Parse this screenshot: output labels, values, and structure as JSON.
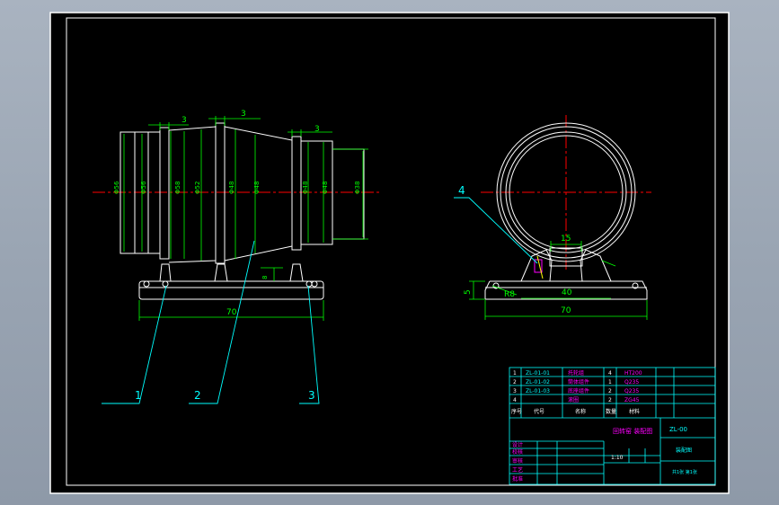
{
  "colors": {
    "background": "#000000",
    "frame": "#ffffff",
    "geometry": "#ffffff",
    "dimension": "#00ff00",
    "centerline": "#ff0000",
    "leader": "#00ffff",
    "table_line": "#00ffff",
    "table_text": "#ff00ff"
  },
  "front_view": {
    "top_dims": [
      "3",
      "3",
      "3"
    ],
    "bottom_dim": "70",
    "right_dim": "8",
    "diameter_labels": [
      "Φ56",
      "Φ56",
      "Φ58",
      "Φ52",
      "Φ48",
      "Φ48",
      "Φ48",
      "Φ48",
      "Φ44",
      "Φ44",
      "Φ38"
    ]
  },
  "side_view": {
    "ring_top_dim": "15",
    "foot_height_dim": "5",
    "radius_dim": "R8",
    "span_dim": "40",
    "base_dim": "70"
  },
  "callouts": [
    "1",
    "2",
    "3",
    "4"
  ],
  "title_block": {
    "rows": [
      {
        "no": "1",
        "code": "ZL-01-01",
        "name": "托轮组",
        "qty": "4",
        "mat": "HT200"
      },
      {
        "no": "2",
        "code": "ZL-01-02",
        "name": "筒体组件",
        "qty": "1",
        "mat": "Q235"
      },
      {
        "no": "3",
        "code": "ZL-01-03",
        "name": "底座组件",
        "qty": "2",
        "mat": "Q235"
      },
      {
        "no": "4",
        "code": "",
        "name": "滚圈",
        "qty": "2",
        "mat": "ZG45"
      }
    ],
    "header": [
      "序号",
      "代号",
      "名称",
      "数量",
      "材料"
    ],
    "design_title": "回转窑 装配图",
    "drawing_no": "ZL-00",
    "assembly_label": "装配图",
    "scale": "1:10",
    "sheet": "共1张 第1张",
    "signature_labels": [
      "设计",
      "校核",
      "审核",
      "工艺",
      "批准"
    ]
  }
}
